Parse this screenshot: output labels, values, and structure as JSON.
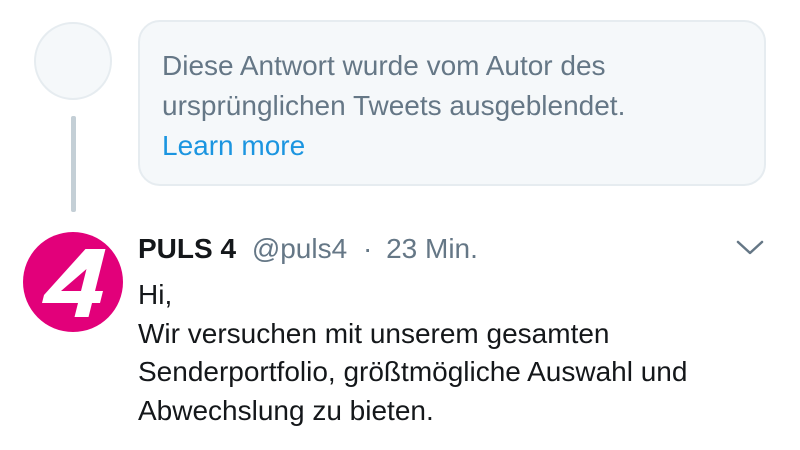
{
  "hidden_reply": {
    "message": "Diese Antwort wurde vom Autor des ursprünglichen Tweets ausgeblendet.",
    "line1": "Diese Antwort wurde vom Autor des",
    "line2": "ursprünglichen Tweets ausgeblendet.",
    "learn_more": "Learn more"
  },
  "tweet": {
    "display_name": "PULS 4",
    "handle": "@puls4",
    "separator": "·",
    "timestamp": "23 Min.",
    "avatar_glyph": "4",
    "body_lines": [
      "Hi,",
      "Wir versuchen mit unserem gesamten",
      "Senderportfolio, größtmögliche Auswahl und",
      "Abwechslung zu bieten."
    ]
  },
  "icons": {
    "hidden_avatar": "placeholder-avatar-icon",
    "menu": "chevron-down-icon"
  },
  "colors": {
    "brand_magenta": "#e2007a",
    "link_blue": "#1b95e0",
    "muted_gray": "#657786",
    "box_background": "#f5f8fa",
    "border_gray": "#e6ecf0"
  }
}
